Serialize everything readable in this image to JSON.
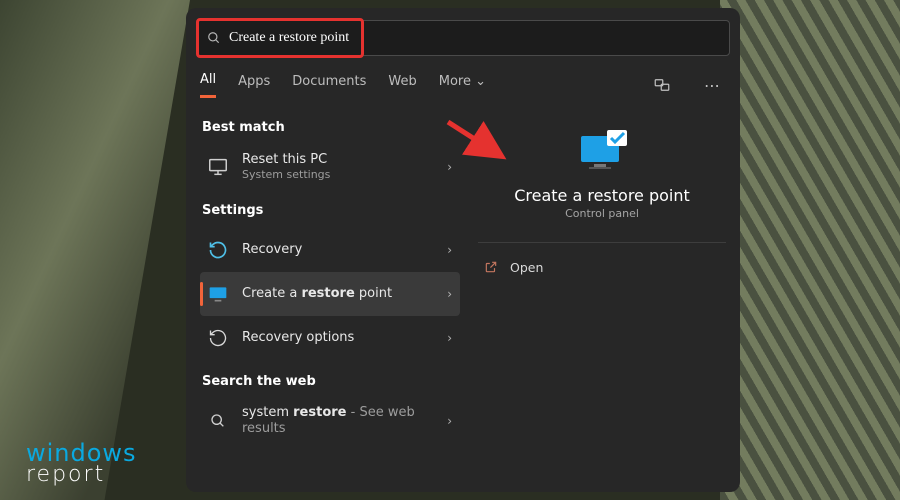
{
  "search": {
    "query": "Create a restore point"
  },
  "tabs": {
    "items": [
      "All",
      "Apps",
      "Documents",
      "Web",
      "More"
    ],
    "active": 0,
    "more_glyph": "⌄"
  },
  "sections": {
    "best_match": {
      "heading": "Best match",
      "item": {
        "title": "Reset this PC",
        "subtitle": "System settings"
      }
    },
    "settings": {
      "heading": "Settings",
      "items": [
        {
          "label": "Recovery",
          "selected": false,
          "icon": "recovery-icon"
        },
        {
          "label_pre": "Create a ",
          "label_bold": "restore",
          "label_post": " point",
          "selected": true,
          "icon": "restore-point-icon"
        },
        {
          "label": "Recovery options",
          "selected": false,
          "icon": "recovery-options-icon"
        }
      ]
    },
    "web": {
      "heading": "Search the web",
      "item": {
        "query_pre": "system ",
        "query_bold": "restore",
        "suffix": " - See web results"
      }
    }
  },
  "detail": {
    "title": "Create a restore point",
    "subtitle": "Control panel",
    "actions": {
      "open": "Open"
    }
  },
  "watermark": {
    "line1": "windows",
    "line2": "report"
  },
  "colors": {
    "accent": "#f2643a",
    "annotation": "#e5322f"
  }
}
